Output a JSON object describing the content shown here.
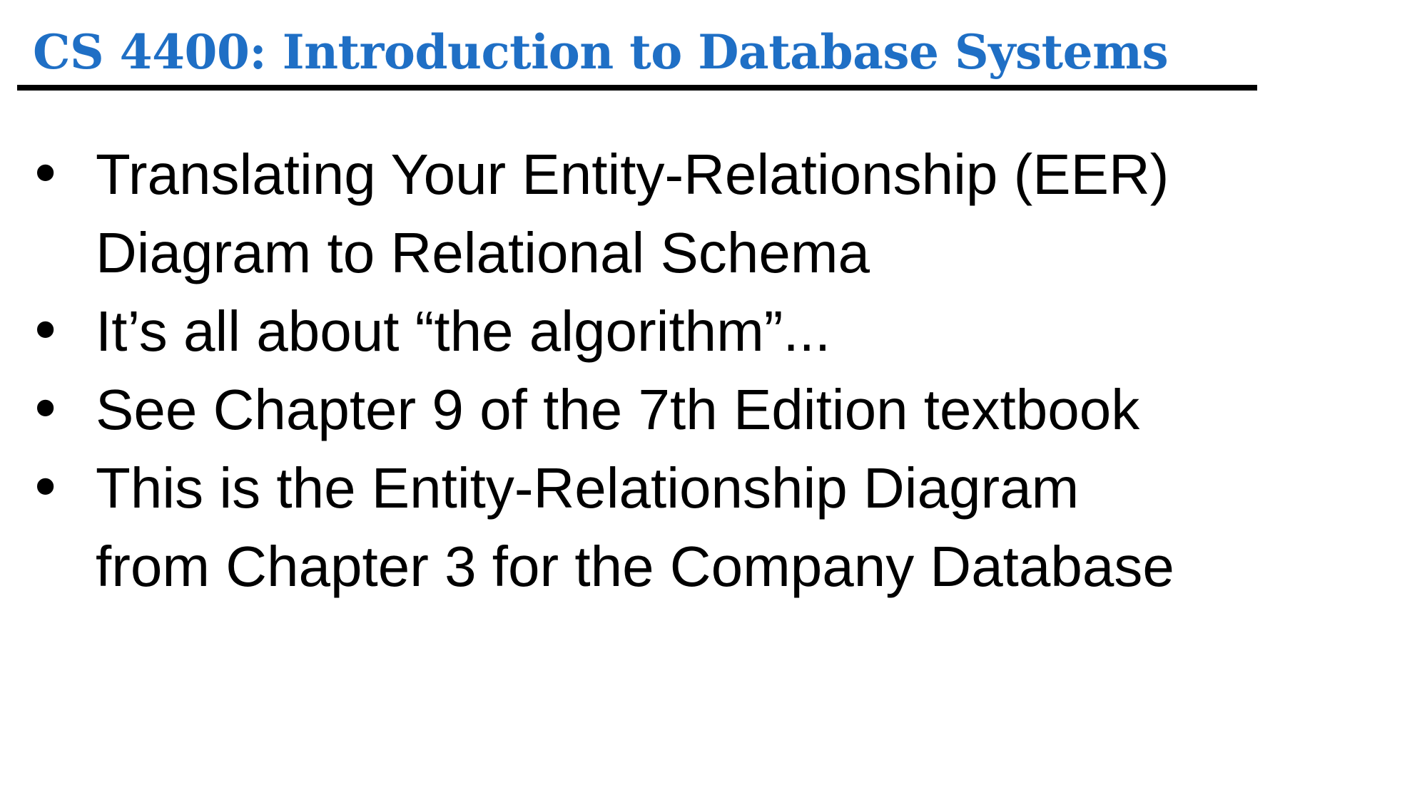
{
  "slide": {
    "title": "CS 4400: Introduction to Database Systems",
    "bullet_symbol": "•",
    "bullets": [
      {
        "lines": [
          "Translating Your Entity-Relationship (EER)",
          "Diagram to Relational Schema"
        ]
      },
      {
        "lines": [
          "It’s all about “the algorithm”..."
        ]
      },
      {
        "lines": [
          "See Chapter 9 of the 7th Edition textbook"
        ]
      },
      {
        "lines": [
          "This is the Entity-Relationship Diagram",
          "from Chapter 3 for the Company Database"
        ]
      }
    ]
  },
  "colors": {
    "title": "#1f6fc5",
    "rule": "#000000",
    "text": "#000000",
    "background": "#ffffff"
  }
}
